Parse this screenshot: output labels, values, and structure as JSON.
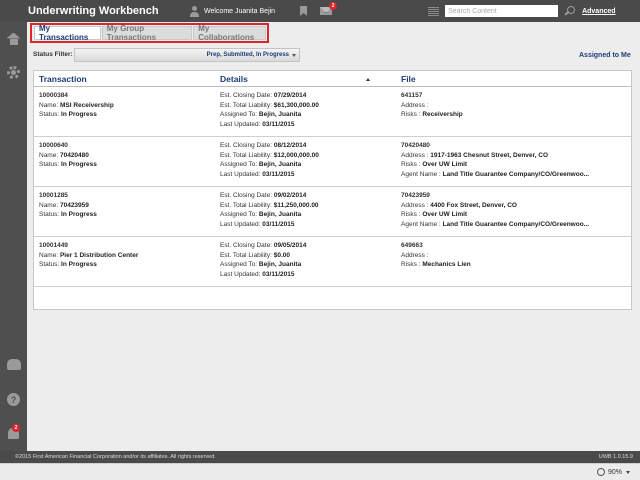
{
  "header": {
    "title": "Underwriting Workbench",
    "welcome": "Welcome Juanita Bejin",
    "mail_badge": "2",
    "search_placeholder": "Search Content",
    "advanced_label": "Advanced"
  },
  "sidebar": {
    "help_glyph": "?",
    "bell_badge": "2"
  },
  "tabs": [
    "My Transactions",
    "My Group Transactions",
    "My Collaborations"
  ],
  "filter": {
    "label": "Status Filter:",
    "value": "Prep, Submitted, In Progress",
    "assigned_link": "Assigned to Me"
  },
  "table": {
    "headers": [
      "Transaction",
      "Details",
      "File"
    ],
    "rows": [
      {
        "txn_id": "10000384",
        "name_label": "Name:",
        "name": "MSI Receivership",
        "status_label": "Status:",
        "status": "In Progress",
        "closing_label": "Est. Closing Date:",
        "closing": "07/29/2014",
        "liability_label": "Est. Total Liability:",
        "liability": "$61,300,000.00",
        "assigned_label": "Assigned To:",
        "assigned": "Bejin, Juanita",
        "updated_label": "Last Updated:",
        "updated": "03/11/2015",
        "file_id": "641157",
        "address_label": "Address :",
        "address": "",
        "risks_label": "Risks :",
        "risks": "Receivership",
        "agent_label": "",
        "agent": ""
      },
      {
        "txn_id": "10000640",
        "name_label": "Name:",
        "name": "70420480",
        "status_label": "Status:",
        "status": "In Progress",
        "closing_label": "Est. Closing Date:",
        "closing": "08/12/2014",
        "liability_label": "Est. Total Liability:",
        "liability": "$12,000,000.00",
        "assigned_label": "Assigned To:",
        "assigned": "Bejin, Juanita",
        "updated_label": "Last Updated:",
        "updated": "03/11/2015",
        "file_id": "70420480",
        "address_label": "Address :",
        "address": "1917-1963 Chesnut Street, Denver, CO",
        "risks_label": "Risks :",
        "risks": "Over UW Limit",
        "agent_label": "Agent Name :",
        "agent": "Land Title Guarantee Company/CO/Greenwoo..."
      },
      {
        "txn_id": "10001285",
        "name_label": "Name:",
        "name": "70423959",
        "status_label": "Status:",
        "status": "In Progress",
        "closing_label": "Est. Closing Date:",
        "closing": "09/02/2014",
        "liability_label": "Est. Total Liability:",
        "liability": "$11,250,000.00",
        "assigned_label": "Assigned To:",
        "assigned": "Bejin, Juanita",
        "updated_label": "Last Updated:",
        "updated": "03/11/2015",
        "file_id": "70423959",
        "address_label": "Address :",
        "address": "4400 Fox Street, Denver, CO",
        "risks_label": "Risks :",
        "risks": "Over UW Limit",
        "agent_label": "Agent Name :",
        "agent": "Land Title Guarantee Company/CO/Greenwoo..."
      },
      {
        "txn_id": "10001449",
        "name_label": "Name:",
        "name": "Pier 1 Distribution Center",
        "status_label": "Status:",
        "status": "In Progress",
        "closing_label": "Est. Closing Date:",
        "closing": "09/05/2014",
        "liability_label": "Est. Total Liability:",
        "liability": "$0.00",
        "assigned_label": "Assigned To:",
        "assigned": "Bejin, Juanita",
        "updated_label": "Last Updated:",
        "updated": "03/11/2015",
        "file_id": "649663",
        "address_label": "Address :",
        "address": "",
        "risks_label": "Risks :",
        "risks": "Mechanics Lien",
        "agent_label": "",
        "agent": ""
      }
    ]
  },
  "footer": {
    "copyright": "©2015 First American Financial Corporation and/or its affiliates. All rights reserved.",
    "version": "UWB 1.0.15.9"
  },
  "statusbar": {
    "zoom": "90%"
  }
}
